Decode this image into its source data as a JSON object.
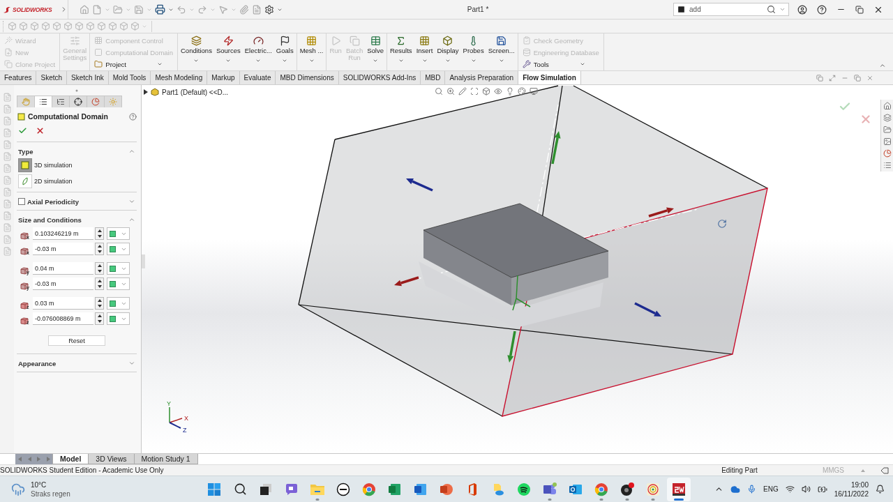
{
  "title_bar": {
    "logo": "SOLIDWORKS",
    "document_title": "Part1 *",
    "search": {
      "value": "add"
    }
  },
  "ribbon": {
    "groups": [
      {
        "kind": "stack",
        "items": [
          {
            "kind": "wizard",
            "label": "Wizard",
            "disabled": true,
            "dropdown": false
          },
          {
            "kind": "new",
            "label": "New",
            "disabled": true,
            "dropdown": false
          },
          {
            "kind": "clone",
            "label": "Clone Project",
            "disabled": true,
            "dropdown": false
          }
        ]
      },
      {
        "kind": "large",
        "items": [
          {
            "kind": "settings",
            "label": "General Settings",
            "disabled": true,
            "dropdown": false
          }
        ]
      },
      {
        "kind": "stack",
        "items": [
          {
            "kind": "control",
            "label": "Component Control",
            "disabled": true,
            "dropdown": false
          },
          {
            "kind": "domain",
            "label": "Computational Domain",
            "disabled": true,
            "dropdown": false
          },
          {
            "kind": "project",
            "label": "Project",
            "disabled": false,
            "dropdown": true
          }
        ]
      },
      {
        "kind": "large",
        "items": [
          {
            "kind": "conditions",
            "label": "Conditions",
            "disabled": false,
            "dropdown": true
          },
          {
            "kind": "sources",
            "label": "Sources",
            "disabled": false,
            "dropdown": true
          },
          {
            "kind": "electric",
            "label": "Electric...",
            "disabled": false,
            "dropdown": true
          },
          {
            "kind": "goals",
            "label": "Goals",
            "disabled": false,
            "dropdown": true
          }
        ]
      },
      {
        "kind": "large",
        "items": [
          {
            "kind": "mesh",
            "label": "Mesh ...",
            "disabled": false,
            "dropdown": true
          }
        ]
      },
      {
        "kind": "large",
        "items": [
          {
            "kind": "run",
            "label": "Run",
            "disabled": true,
            "dropdown": false
          },
          {
            "kind": "batch",
            "label": "Batch Run",
            "disabled": true,
            "dropdown": false
          },
          {
            "kind": "solve",
            "label": "Solve",
            "disabled": false,
            "dropdown": true
          }
        ]
      },
      {
        "kind": "large",
        "items": [
          {
            "kind": "results",
            "label": "Results",
            "disabled": false,
            "dropdown": true
          },
          {
            "kind": "insert",
            "label": "Insert",
            "disabled": false,
            "dropdown": true
          },
          {
            "kind": "display",
            "label": "Display",
            "disabled": false,
            "dropdown": true
          },
          {
            "kind": "probes",
            "label": "Probes",
            "disabled": false,
            "dropdown": true
          },
          {
            "kind": "screen",
            "label": "Screen...",
            "disabled": false,
            "dropdown": true
          }
        ]
      },
      {
        "kind": "stack",
        "items": [
          {
            "kind": "check",
            "label": "Check Geometry",
            "disabled": true,
            "dropdown": false
          },
          {
            "kind": "database",
            "label": "Engineering Database",
            "disabled": true,
            "dropdown": false
          },
          {
            "kind": "tools",
            "label": "Tools",
            "disabled": false,
            "dropdown": true
          }
        ]
      }
    ]
  },
  "command_tabs": [
    {
      "label": "Features",
      "selected": false
    },
    {
      "label": "Sketch",
      "selected": false
    },
    {
      "label": "Sketch Ink",
      "selected": false
    },
    {
      "label": "Mold Tools",
      "selected": false
    },
    {
      "label": "Mesh Modeling",
      "selected": false
    },
    {
      "label": "Markup",
      "selected": false
    },
    {
      "label": "Evaluate",
      "selected": false
    },
    {
      "label": "MBD Dimensions",
      "selected": false
    },
    {
      "label": "SOLIDWORKS Add-Ins",
      "selected": false
    },
    {
      "label": "MBD",
      "selected": false
    },
    {
      "label": "Analysis Preparation",
      "selected": false
    },
    {
      "label": "Flow Simulation",
      "selected": true
    }
  ],
  "feature_tree": {
    "root": "Part1 (Default) <<D..."
  },
  "property_manager": {
    "tabs": [
      {
        "selected": false
      },
      {
        "selected": true
      },
      {
        "selected": false
      },
      {
        "selected": false
      },
      {
        "selected": false
      },
      {
        "selected": false
      }
    ],
    "title": "Computational Domain",
    "sections": [
      {
        "kind": "type",
        "title": "Type",
        "expanded": true,
        "options": [
          {
            "label": "3D simulation",
            "selected": true
          },
          {
            "label": "2D simulation",
            "selected": false
          }
        ]
      },
      {
        "kind": "check",
        "title": "Axial Periodicity",
        "checked": false,
        "expanded": false
      },
      {
        "kind": "fields",
        "title": "Size and Conditions",
        "expanded": true,
        "fields": [
          {
            "axis": "x",
            "value": "0.103246219 m"
          },
          {
            "axis": "x",
            "value": "-0.03 m"
          },
          {
            "axis": "y",
            "value": "0.04 m"
          },
          {
            "axis": "y",
            "value": "-0.03 m"
          },
          {
            "axis": "z",
            "value": "0.03 m"
          },
          {
            "axis": "z",
            "value": "-0.076008869 m"
          }
        ],
        "reset": "Reset"
      },
      {
        "kind": "plain",
        "title": "Appearance",
        "expanded": false
      }
    ]
  },
  "triad": {
    "labels": [
      "Y",
      "X",
      "Z"
    ]
  },
  "bottom_tabs": [
    {
      "label": "Model",
      "selected": true
    },
    {
      "label": "3D Views",
      "selected": false
    },
    {
      "label": "Motion Study 1",
      "selected": false
    }
  ],
  "status_bar": {
    "edition": "SOLIDWORKS Student Edition - Academic Use Only",
    "mode": "Editing Part",
    "units": "MMGS"
  },
  "taskbar": {
    "weather": {
      "temperature": "10°C",
      "forecast": "Straks regen"
    },
    "apps": [
      {
        "kind": "start",
        "running": false,
        "active": false
      },
      {
        "kind": "search",
        "running": false,
        "active": false
      },
      {
        "kind": "taskview",
        "running": false,
        "active": false
      },
      {
        "kind": "chat",
        "running": false,
        "active": false
      },
      {
        "kind": "explorer",
        "running": true,
        "active": false
      },
      {
        "kind": "dell",
        "running": false,
        "active": false
      },
      {
        "kind": "chrome",
        "running": false,
        "active": false
      },
      {
        "kind": "excel",
        "running": false,
        "active": false
      },
      {
        "kind": "word",
        "running": false,
        "active": false
      },
      {
        "kind": "powerpoint",
        "running": false,
        "active": false
      },
      {
        "kind": "office",
        "running": false,
        "active": false
      },
      {
        "kind": "drive",
        "running": false,
        "active": false
      },
      {
        "kind": "spotify",
        "running": false,
        "active": false
      },
      {
        "kind": "teams",
        "running": true,
        "active": false
      },
      {
        "kind": "outlook",
        "running": false,
        "active": false
      },
      {
        "kind": "chrome",
        "running": true,
        "active": false
      },
      {
        "kind": "obs",
        "running": true,
        "active": false
      },
      {
        "kind": "target",
        "running": true,
        "active": false
      },
      {
        "kind": "cad",
        "running": true,
        "active": true
      }
    ],
    "language": "ENG",
    "time": "19:00",
    "date": "16/11/2022"
  }
}
